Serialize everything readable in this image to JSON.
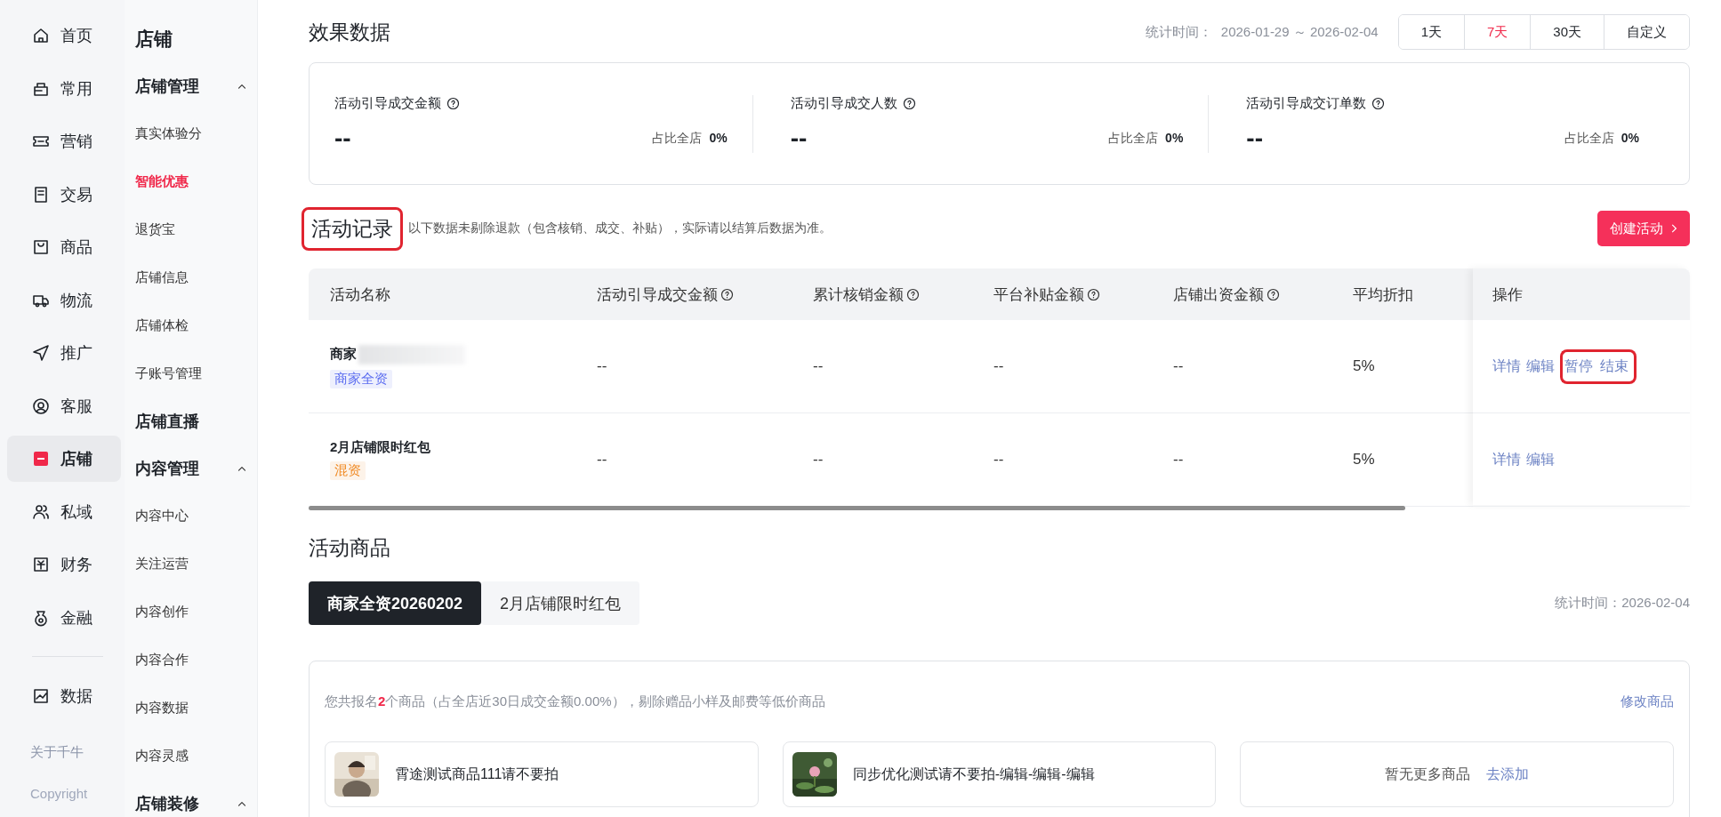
{
  "rail": {
    "items": [
      {
        "label": "首页",
        "selected": false
      },
      {
        "label": "常用",
        "selected": false
      },
      {
        "label": "营销",
        "selected": false
      },
      {
        "label": "交易",
        "selected": false
      },
      {
        "label": "商品",
        "selected": false
      },
      {
        "label": "物流",
        "selected": false
      },
      {
        "label": "推广",
        "selected": false
      },
      {
        "label": "客服",
        "selected": false
      },
      {
        "label": "店铺",
        "selected": true
      },
      {
        "label": "私域",
        "selected": false
      },
      {
        "label": "财务",
        "selected": false
      },
      {
        "label": "金融",
        "selected": false
      }
    ],
    "bottom_items": [
      {
        "label": "数据",
        "selected": false
      }
    ],
    "about": "关于千牛",
    "copyright": "Copyright"
  },
  "menu": {
    "title": "店铺",
    "groups": [
      {
        "kind": "group",
        "label": "店铺管理",
        "expanded": true,
        "children": [
          {
            "label": "真实体验分",
            "selected": false
          },
          {
            "label": "智能优惠",
            "selected": true
          },
          {
            "label": "退货宝",
            "selected": false
          },
          {
            "label": "店铺信息",
            "selected": false
          },
          {
            "label": "店铺体检",
            "selected": false
          },
          {
            "label": "子账号管理",
            "selected": false
          }
        ]
      },
      {
        "kind": "entry",
        "label": "店铺直播"
      },
      {
        "kind": "group",
        "label": "内容管理",
        "expanded": true,
        "children": [
          {
            "label": "内容中心",
            "selected": false
          },
          {
            "label": "关注运营",
            "selected": false
          },
          {
            "label": "内容创作",
            "selected": false
          },
          {
            "label": "内容合作",
            "selected": false
          },
          {
            "label": "内容数据",
            "selected": false
          },
          {
            "label": "内容灵感",
            "selected": false
          }
        ]
      },
      {
        "kind": "group",
        "label": "店铺装修",
        "expanded": true
      }
    ]
  },
  "effect": {
    "title": "效果数据",
    "period_label": "统计时间：",
    "period": "2026-01-29 ～ 2026-02-04",
    "ranges": [
      {
        "label": "1天",
        "selected": false
      },
      {
        "label": "7天",
        "selected": true
      },
      {
        "label": "30天",
        "selected": false
      },
      {
        "label": "自定义",
        "selected": false
      }
    ],
    "metrics": [
      {
        "label": "活动引导成交金额",
        "value": "--",
        "share_label": "占比全店",
        "share": "0%"
      },
      {
        "label": "活动引导成交人数",
        "value": "--",
        "share_label": "占比全店",
        "share": "0%"
      },
      {
        "label": "活动引导成交订单数",
        "value": "--",
        "share_label": "占比全店",
        "share": "0%"
      }
    ]
  },
  "records": {
    "title": "活动记录",
    "highlighted": true,
    "note": "以下数据未剔除退款（包含核销、成交、补贴），实际请以结算后数据为准。",
    "create_button": "创建活动",
    "name_column": "活动名称",
    "columns": [
      {
        "label": "活动引导成交金额",
        "help": true
      },
      {
        "label": "累计核销金额",
        "help": true
      },
      {
        "label": "平台补贴金额",
        "help": true
      },
      {
        "label": "店铺出资金额",
        "help": true
      },
      {
        "label": "平均折扣",
        "help": false
      }
    ],
    "actions_column": "操作",
    "rows": [
      {
        "name": "商家",
        "redacted": true,
        "tag": {
          "label": "商家全资",
          "color": "#5b6cf0"
        },
        "cells": [
          "--",
          "--",
          "--",
          "--",
          "5%"
        ],
        "actions": [
          {
            "label": "详情",
            "highlighted": false
          },
          {
            "label": "编辑",
            "highlighted": false
          },
          {
            "label": "暂停",
            "highlighted": true
          },
          {
            "label": "结束",
            "highlighted": true
          }
        ]
      },
      {
        "name": "2月店铺限时红包",
        "redacted": false,
        "tag": {
          "label": "混资",
          "color": "#f08a24"
        },
        "cells": [
          "--",
          "--",
          "--",
          "--",
          "5%"
        ],
        "actions": [
          {
            "label": "详情",
            "highlighted": false
          },
          {
            "label": "编辑",
            "highlighted": false
          }
        ]
      }
    ]
  },
  "goods": {
    "title": "活动商品",
    "tabs": [
      {
        "label": "商家全资20260202",
        "selected": true
      },
      {
        "label": "2月店铺限时红包",
        "selected": false
      }
    ],
    "stat_time": "统计时间：2026-02-04",
    "note": "您共报名**2**个商品（占全店近30日成交金额0.00%），剔除赠品小样及邮费等低价商品",
    "edit_link": "修改商品",
    "items": [
      {
        "kind": "product",
        "name": "霄途测试商品111请不要拍"
      },
      {
        "kind": "product",
        "name": "同步优化测试请不要拍-编辑-编辑-编辑"
      },
      {
        "kind": "empty",
        "text": "暂无更多商品",
        "link": "去添加"
      }
    ]
  }
}
